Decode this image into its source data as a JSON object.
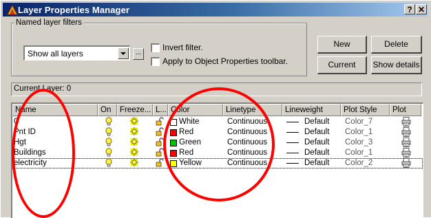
{
  "window": {
    "title": "Layer Properties Manager",
    "help_label": "?",
    "close_label": "✕"
  },
  "filters": {
    "group_label": "Named layer filters",
    "selected_filter": "Show all layers",
    "ellipsis_label": "...",
    "invert_label": "Invert filter.",
    "apply_label": "Apply to Object Properties toolbar."
  },
  "buttons": {
    "new": "New",
    "delete": "Delete",
    "current": "Current",
    "show_details": "Show details"
  },
  "current_layer": "Current Layer:  0",
  "columns": [
    "Name",
    "On",
    "Freeze...",
    "L...",
    "Color",
    "Linetype",
    "Lineweight",
    "Plot Style",
    "Plot"
  ],
  "layers": [
    {
      "name": "0",
      "color_name": "White",
      "color_hex": "#ffffff",
      "linetype": "Continuous",
      "lineweight": "Default",
      "plot_style": "Color_7"
    },
    {
      "name": "Pnt ID",
      "color_name": "Red",
      "color_hex": "#ff0000",
      "linetype": "Continuous",
      "lineweight": "Default",
      "plot_style": "Color_1"
    },
    {
      "name": "Hgt",
      "color_name": "Green",
      "color_hex": "#00c000",
      "linetype": "Continuous",
      "lineweight": "Default",
      "plot_style": "Color_3"
    },
    {
      "name": "Buildings",
      "color_name": "Red",
      "color_hex": "#ff0000",
      "linetype": "Continuous",
      "lineweight": "Default",
      "plot_style": "Color_1"
    },
    {
      "name": "electricity",
      "color_name": "Yellow",
      "color_hex": "#ffff00",
      "linetype": "Continuous",
      "lineweight": "Default",
      "plot_style": "Color_2"
    }
  ],
  "icons": {
    "on": "lightbulb-icon",
    "freeze": "sun-icon",
    "lock": "padlock-icon",
    "plot": "printer-icon"
  },
  "annotation_color": "#ff0000"
}
